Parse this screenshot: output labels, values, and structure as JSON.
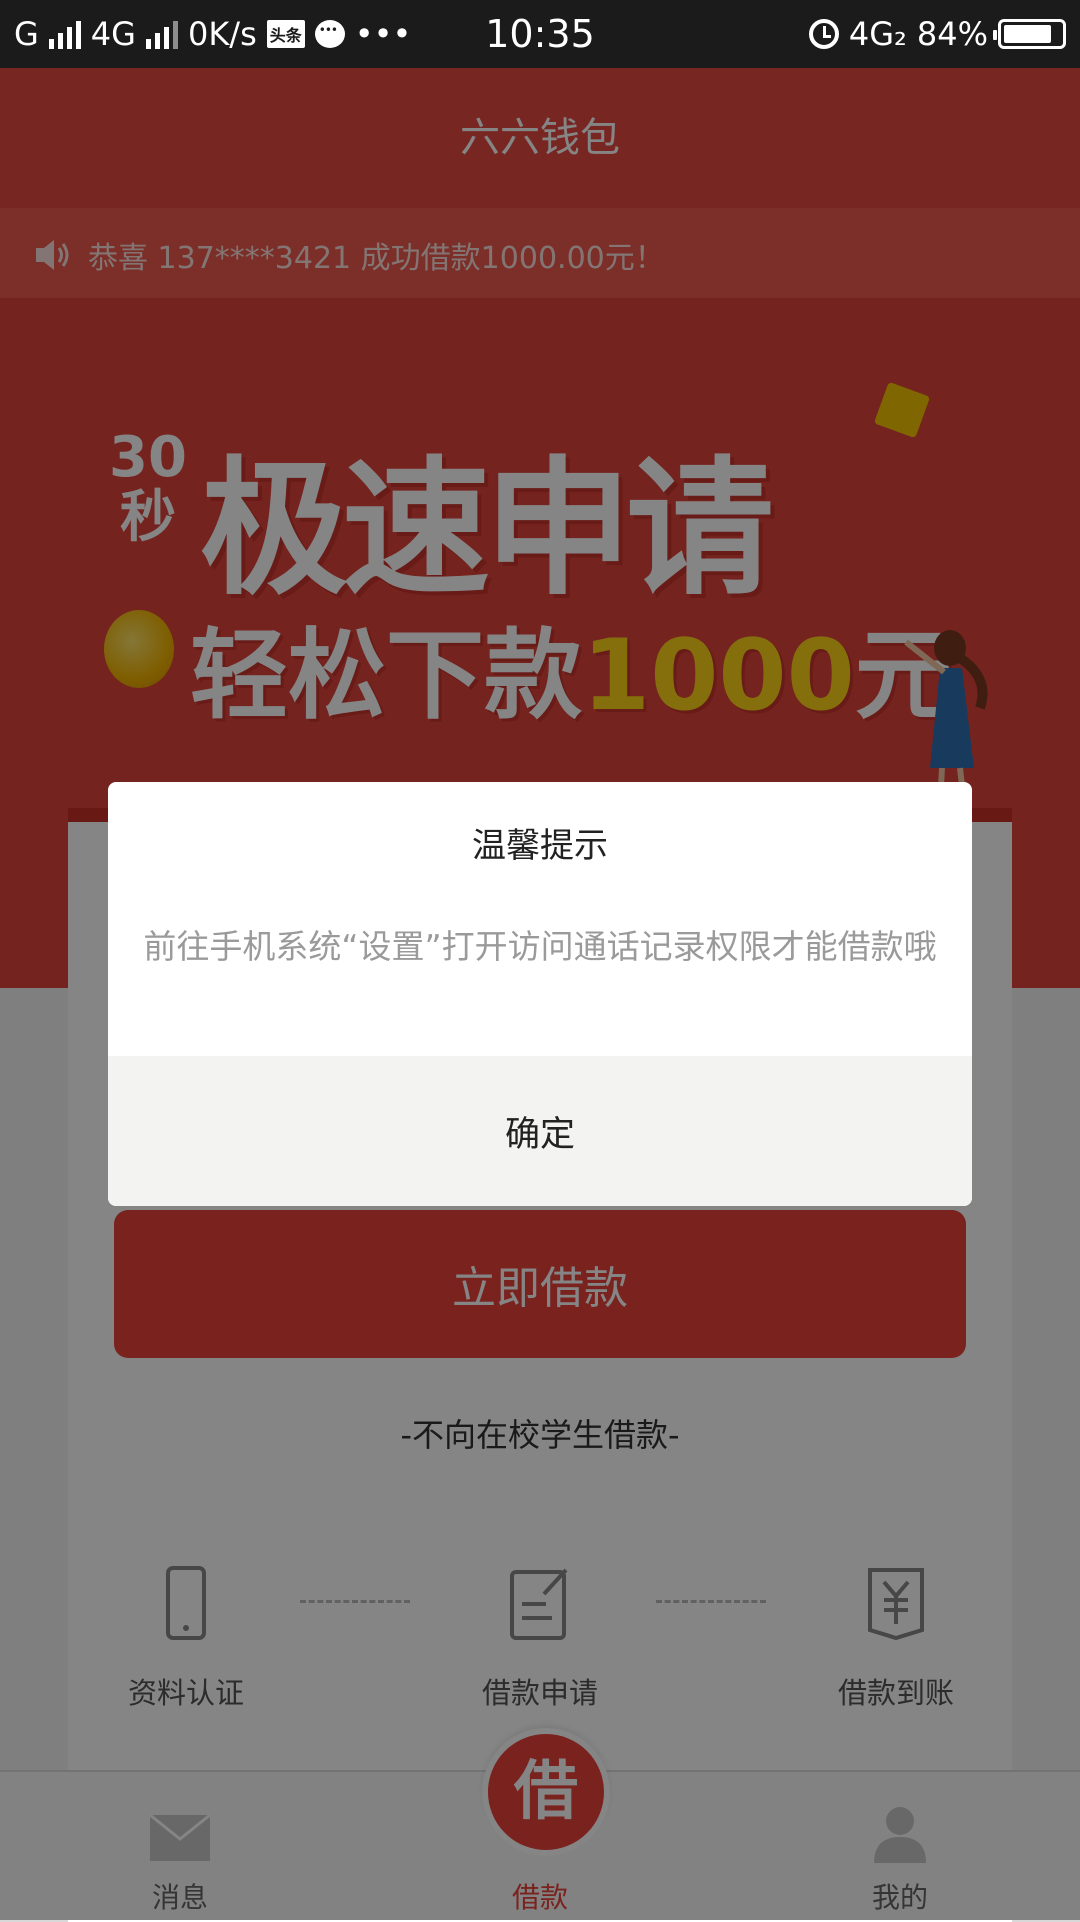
{
  "statusbar": {
    "carrier1": "G",
    "carrier2": "4G",
    "net_speed": "0K/s",
    "news_app_chip": "头条",
    "more": "•••",
    "time": "10:35",
    "net_right": "4G₂",
    "battery": "84%",
    "battery_level": 0.84,
    "icons": [
      "signal-icon",
      "chat-icon",
      "alarm-icon",
      "battery-icon"
    ]
  },
  "app": {
    "title": "六六钱包",
    "notice": "恭喜 137****3421 成功借款1000.00元！",
    "banner": {
      "seconds_top": "30",
      "seconds_bottom": "秒",
      "headline": "极速申请",
      "sub_prefix": "轻松下款",
      "sub_amount": "1000",
      "sub_suffix": "元"
    },
    "loan_button": "立即借款",
    "disclaimer": "-不向在校学生借款-",
    "steps": [
      {
        "label": "资料认证",
        "icon": "phone-icon"
      },
      {
        "label": "借款申请",
        "icon": "form-edit-icon"
      },
      {
        "label": "借款到账",
        "icon": "yuan-receipt-icon"
      }
    ],
    "tabbar": {
      "messages": "消息",
      "loan_char": "借",
      "loan": "借款",
      "mine": "我的"
    }
  },
  "dialog": {
    "title": "温馨提示",
    "message": "前往手机系统“设置”打开访问通话记录权限才能借款哦",
    "confirm": "确定"
  },
  "colors": {
    "brand_red": "#e8423a",
    "overlay": "rgba(0,0,0,0.48)"
  }
}
